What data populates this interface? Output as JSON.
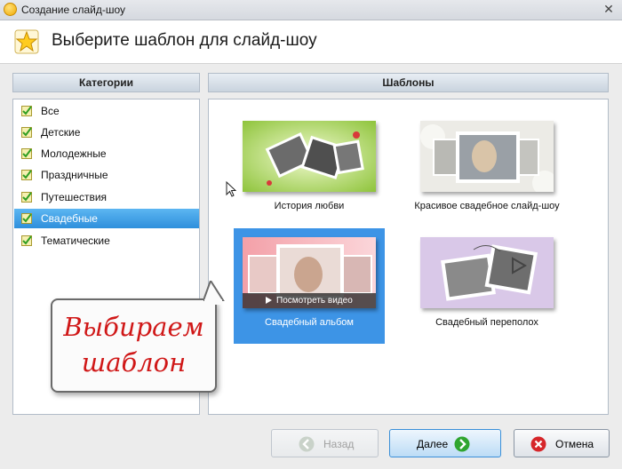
{
  "window": {
    "title": "Создание слайд-шоу",
    "close_glyph": "✕"
  },
  "header": {
    "title": "Выберите шаблон для слайд-шоу",
    "icon": "star-icon"
  },
  "categories": {
    "heading": "Категории",
    "items": [
      {
        "label": "Все",
        "selected": false
      },
      {
        "label": "Детские",
        "selected": false
      },
      {
        "label": "Молодежные",
        "selected": false
      },
      {
        "label": "Праздничные",
        "selected": false
      },
      {
        "label": "Путешествия",
        "selected": false
      },
      {
        "label": "Свадебные",
        "selected": true
      },
      {
        "label": "Тематические",
        "selected": false
      }
    ]
  },
  "templates": {
    "heading": "Шаблоны",
    "items": [
      {
        "caption": "История любви",
        "selected": false
      },
      {
        "caption": "Красивое свадебное слайд-шоу",
        "selected": false
      },
      {
        "caption": "Свадебный альбом",
        "selected": true,
        "preview_label": "Посмотреть видео"
      },
      {
        "caption": "Свадебный переполох",
        "selected": false
      }
    ]
  },
  "callout": {
    "line1": "Выбираем",
    "line2": "шаблон"
  },
  "buttons": {
    "back": {
      "label": "Назад",
      "enabled": false
    },
    "next": {
      "label": "Далее",
      "enabled": true
    },
    "cancel": {
      "label": "Отмена",
      "enabled": true
    }
  },
  "colors": {
    "selection": "#3d94e6",
    "callout_text": "#d01818",
    "next_icon": "#2fa52f",
    "cancel_icon": "#d6262a"
  }
}
